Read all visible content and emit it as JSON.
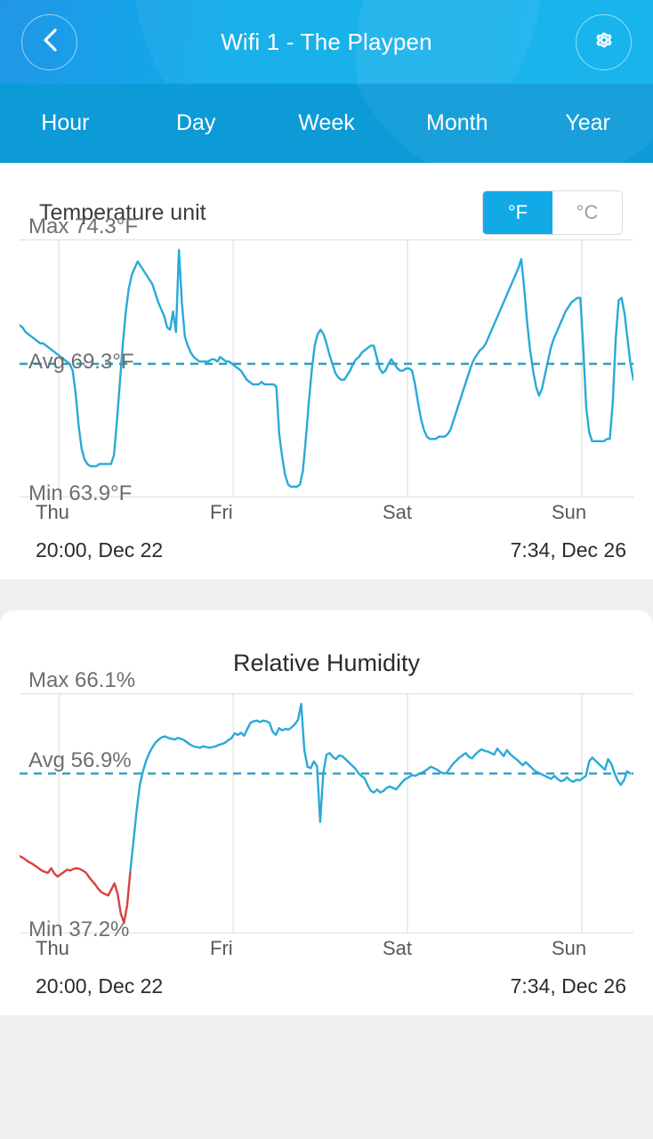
{
  "header": {
    "title": "Wifi 1 - The Playpen",
    "back_icon": "chevron-left-icon",
    "settings_icon": "gear-icon"
  },
  "tabs": [
    {
      "label": "Hour",
      "active": false
    },
    {
      "label": "Day",
      "active": false
    },
    {
      "label": "Week",
      "active": false
    },
    {
      "label": "Month",
      "active": false
    },
    {
      "label": "Year",
      "active": false
    }
  ],
  "temperature_card": {
    "unit_label": "Temperature unit",
    "unit_options": [
      {
        "label": "°F",
        "selected": true
      },
      {
        "label": "°C",
        "selected": false
      }
    ],
    "max_label": "Max 74.3°F",
    "avg_label": "Avg 69.3°F",
    "min_label": "Min 63.9°F",
    "axis_days": [
      "Thu",
      "Fri",
      "Sat",
      "Sun"
    ],
    "range_start": "20:00,  Dec 22",
    "range_end": "7:34,  Dec 26"
  },
  "humidity_card": {
    "title": "Relative Humidity",
    "max_label": "Max 66.1%",
    "avg_label": "Avg 56.9%",
    "min_label": "Min 37.2%",
    "axis_days": [
      "Thu",
      "Fri",
      "Sat",
      "Sun"
    ],
    "range_start": "20:00,  Dec 22",
    "range_end": "7:34,  Dec 26"
  },
  "colors": {
    "header_blue": "#0eace8",
    "tabbar_blue": "#0d9bd8",
    "accent": "#12aae6",
    "line_blue": "#29a9d8",
    "line_red": "#d94040",
    "grid": "#e3e3e3",
    "page_bg": "#f0f0f0"
  },
  "chart_data": [
    {
      "type": "line",
      "name": "temperature",
      "title": "",
      "ylabel": "°F",
      "xlabel": "",
      "unit": "°F",
      "max": 74.3,
      "avg": 69.3,
      "min": 63.9,
      "ylim": [
        63.9,
        74.3
      ],
      "grid": true,
      "legend": "none",
      "x_tick_labels": [
        "Thu",
        "Fri",
        "Sat",
        "Sun"
      ],
      "x_tick_positions": [
        0.064,
        0.348,
        0.632,
        0.916
      ],
      "x_range_start": "20:00,  Dec 22",
      "x_range_end": "7:34,  Dec 26",
      "avg_reference_line": 69.3,
      "series": [
        {
          "name": "Temperature",
          "color": "#29a9d8",
          "values": [
            71.0,
            70.9,
            70.7,
            70.6,
            70.5,
            70.4,
            70.3,
            70.2,
            70.2,
            70.1,
            70.0,
            69.9,
            69.8,
            69.7,
            69.6,
            69.5,
            69.4,
            69.3,
            69.0,
            68.0,
            66.6,
            65.6,
            65.1,
            64.9,
            64.8,
            64.8,
            64.8,
            64.9,
            64.9,
            64.9,
            64.9,
            64.9,
            65.3,
            66.8,
            68.5,
            70.2,
            71.6,
            72.6,
            73.2,
            73.5,
            73.8,
            73.6,
            73.4,
            73.2,
            73.0,
            72.8,
            72.4,
            72.0,
            71.7,
            71.4,
            70.9,
            70.8,
            71.6,
            70.7,
            74.3,
            72.0,
            70.5,
            70.1,
            69.8,
            69.6,
            69.5,
            69.4,
            69.4,
            69.4,
            69.4,
            69.5,
            69.5,
            69.4,
            69.6,
            69.5,
            69.4,
            69.4,
            69.3,
            69.2,
            69.1,
            69.0,
            68.8,
            68.6,
            68.5,
            68.4,
            68.4,
            68.4,
            68.5,
            68.4,
            68.4,
            68.4,
            68.4,
            68.3,
            66.2,
            65.2,
            64.4,
            64.0,
            63.9,
            63.9,
            63.9,
            64.0,
            64.6,
            66.0,
            67.6,
            69.0,
            70.1,
            70.6,
            70.8,
            70.6,
            70.2,
            69.7,
            69.3,
            68.9,
            68.7,
            68.6,
            68.6,
            68.8,
            69.0,
            69.3,
            69.5,
            69.6,
            69.8,
            69.9,
            70.0,
            70.1,
            70.1,
            69.6,
            69.1,
            68.9,
            69.0,
            69.3,
            69.5,
            69.3,
            69.1,
            69.0,
            69.0,
            69.1,
            69.1,
            69.0,
            68.4,
            67.6,
            66.9,
            66.4,
            66.1,
            66.0,
            66.0,
            66.0,
            66.1,
            66.1,
            66.1,
            66.2,
            66.4,
            66.8,
            67.2,
            67.6,
            68.0,
            68.4,
            68.8,
            69.2,
            69.5,
            69.7,
            69.9,
            70.0,
            70.2,
            70.5,
            70.8,
            71.1,
            71.4,
            71.7,
            72.0,
            72.3,
            72.6,
            72.9,
            73.2,
            73.5,
            73.9,
            72.6,
            71.1,
            69.9,
            69.0,
            68.3,
            67.9,
            68.2,
            68.8,
            69.4,
            70.0,
            70.4,
            70.7,
            71.0,
            71.3,
            71.6,
            71.8,
            72.0,
            72.1,
            72.2,
            72.2,
            70.0,
            67.4,
            66.3,
            65.9,
            65.9,
            65.9,
            65.9,
            65.9,
            66.0,
            66.0,
            67.6,
            70.4,
            72.1,
            72.2,
            71.5,
            70.4,
            69.3,
            68.6
          ]
        }
      ]
    },
    {
      "type": "line",
      "name": "relative_humidity",
      "title": "Relative Humidity",
      "ylabel": "%",
      "xlabel": "",
      "unit": "%",
      "max": 66.1,
      "avg": 56.9,
      "min": 37.2,
      "ylim": [
        37.2,
        66.1
      ],
      "grid": true,
      "legend": "none",
      "x_tick_labels": [
        "Thu",
        "Fri",
        "Sat",
        "Sun"
      ],
      "x_tick_positions": [
        0.064,
        0.348,
        0.632,
        0.916
      ],
      "x_range_start": "20:00,  Dec 22",
      "x_range_end": "7:34,  Dec 26",
      "avg_reference_line": 56.9,
      "series": [
        {
          "name": "Relative Humidity (low)",
          "color": "#d94040",
          "segment": "start",
          "values": [
            46.0,
            45.8,
            45.5,
            45.2,
            45.0,
            44.7,
            44.4,
            44.1,
            43.9,
            43.8,
            44.4,
            43.7,
            43.3,
            43.6,
            43.9,
            44.2,
            44.1,
            44.3,
            44.4,
            44.3,
            44.1,
            43.8,
            43.2,
            42.7,
            42.2,
            41.6,
            41.2,
            41.0,
            40.8,
            41.6,
            42.4,
            41.0,
            38.4,
            37.2,
            39.5,
            44.0
          ]
        },
        {
          "name": "Relative Humidity",
          "color": "#29a9d8",
          "segment": "main",
          "values": [
            44.0,
            48.0,
            52.0,
            55.4,
            57.2,
            58.6,
            59.6,
            60.4,
            61.0,
            61.4,
            61.7,
            61.8,
            61.6,
            61.5,
            61.4,
            61.6,
            61.5,
            61.3,
            61.0,
            60.7,
            60.5,
            60.4,
            60.3,
            60.5,
            60.4,
            60.3,
            60.4,
            60.5,
            60.7,
            60.8,
            61.0,
            61.3,
            61.6,
            62.2,
            62.0,
            62.3,
            61.9,
            62.8,
            63.6,
            63.8,
            63.9,
            63.7,
            63.9,
            63.8,
            63.6,
            62.4,
            62.0,
            62.9,
            62.6,
            62.8,
            62.7,
            63.0,
            63.4,
            64.0,
            66.1,
            60.0,
            57.8,
            57.6,
            58.5,
            57.9,
            50.5,
            57.0,
            59.4,
            59.6,
            59.1,
            58.8,
            59.3,
            59.2,
            58.8,
            58.4,
            58.0,
            57.6,
            57.0,
            56.6,
            56.3,
            55.4,
            54.6,
            54.4,
            54.8,
            54.4,
            54.6,
            55.0,
            55.2,
            55.0,
            54.8,
            55.3,
            55.8,
            56.2,
            56.4,
            56.7,
            56.6,
            56.8,
            57.0,
            57.2,
            57.5,
            57.8,
            57.6,
            57.4,
            57.1,
            56.9,
            57.0,
            57.6,
            58.2,
            58.6,
            59.0,
            59.3,
            59.6,
            59.1,
            58.9,
            59.4,
            59.8,
            60.1,
            59.9,
            59.8,
            59.6,
            59.4,
            60.2,
            59.7,
            59.2,
            60.0,
            59.5,
            59.1,
            58.8,
            58.4,
            58.0,
            58.4,
            58.0,
            57.6,
            57.2,
            57.0,
            56.8,
            56.6,
            56.4,
            56.2,
            56.6,
            56.2,
            55.9,
            56.0,
            56.4,
            56.0,
            55.8,
            56.1,
            56.0,
            56.3,
            56.6,
            58.5,
            59.0,
            58.6,
            58.2,
            57.8,
            57.4,
            58.8,
            58.2,
            57.0,
            56.0,
            55.4,
            56.0,
            57.2,
            56.9
          ]
        }
      ]
    }
  ]
}
